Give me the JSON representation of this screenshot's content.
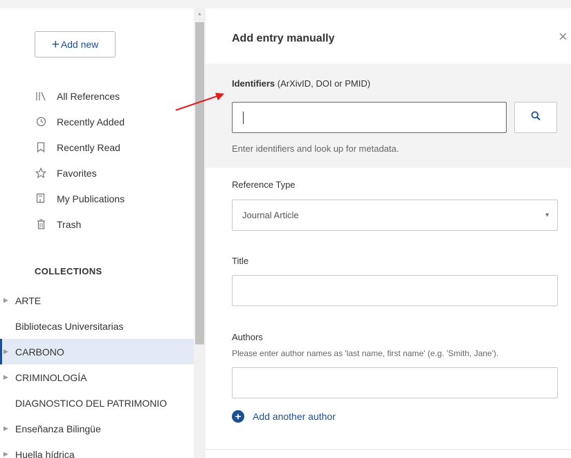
{
  "sidebar": {
    "add_new_plus": "+",
    "add_new_label": "Add new",
    "nav": [
      {
        "label": "All References",
        "icon": "library-icon"
      },
      {
        "label": "Recently Added",
        "icon": "clock-icon"
      },
      {
        "label": "Recently Read",
        "icon": "bookmark-icon"
      },
      {
        "label": "Favorites",
        "icon": "star-icon"
      },
      {
        "label": "My Publications",
        "icon": "publications-icon"
      },
      {
        "label": "Trash",
        "icon": "trash-icon"
      }
    ],
    "collections_title": "COLLECTIONS",
    "collections": [
      {
        "label": "ARTE",
        "expandable": true,
        "selected": false
      },
      {
        "label": "Bibliotecas Universitarias",
        "expandable": false,
        "selected": false
      },
      {
        "label": "CARBONO",
        "expandable": true,
        "selected": true
      },
      {
        "label": "CRIMINOLOGÍA",
        "expandable": true,
        "selected": false
      },
      {
        "label": "DIAGNOSTICO DEL PATRIMONIO",
        "expandable": false,
        "selected": false
      },
      {
        "label": "Enseñanza Bilingüe",
        "expandable": true,
        "selected": false
      },
      {
        "label": "Huella hídrica",
        "expandable": true,
        "selected": false
      }
    ]
  },
  "panel": {
    "title": "Add entry manually",
    "close_glyph": "×",
    "identifiers": {
      "label_bold": "Identifiers",
      "label_rest": " (ArXivID, DOI or PMID)",
      "value": "",
      "help": "Enter identifiers and look up for metadata."
    },
    "reference_type": {
      "label": "Reference Type",
      "selected": "Journal Article"
    },
    "title_field": {
      "label": "Title",
      "value": ""
    },
    "authors": {
      "label": "Authors",
      "help": "Please enter author names as 'last name, first name' (e.g. 'Smith, Jane').",
      "value": "",
      "add_another_plus": "+",
      "add_another": "Add another author"
    }
  },
  "colors": {
    "accent": "#1d4f91",
    "focus_border": "#2e72c6",
    "selected_bg": "#e3eaf5",
    "annotation_arrow": "#e02020"
  }
}
